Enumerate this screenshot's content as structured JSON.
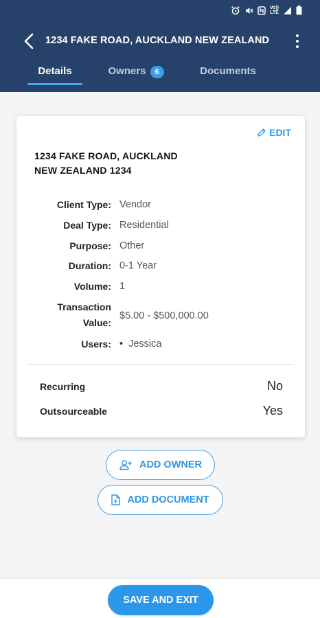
{
  "colors": {
    "header_bg": "#26426a",
    "accent": "#2f9be6",
    "badge": "#3d9cf0",
    "save_button": "#2a97ea"
  },
  "status_bar": {
    "icons": [
      "alarm-icon",
      "mute-icon",
      "nfc-icon",
      "battery-saver-icon",
      "volte-icon",
      "signal-icon",
      "battery-icon"
    ],
    "volte_text": "Vo))\nLTE"
  },
  "header": {
    "title": "1234 FAKE ROAD, AUCKLAND NEW ZEALAND",
    "back_icon": "chevron-left-icon",
    "more_icon": "more-vertical-icon"
  },
  "tabs": [
    {
      "label": "Details",
      "active": true
    },
    {
      "label": "Owners",
      "badge": "6",
      "active": false
    },
    {
      "label": "Documents",
      "active": false
    }
  ],
  "card": {
    "edit_label": "EDIT",
    "edit_icon": "pencil-icon",
    "address_line1": "1234 FAKE ROAD, AUCKLAND",
    "address_line2": "NEW ZEALAND 1234",
    "fields": [
      {
        "label": "Client Type:",
        "value": "Vendor"
      },
      {
        "label": "Deal Type:",
        "value": "Residential"
      },
      {
        "label": "Purpose:",
        "value": "Other"
      },
      {
        "label": "Duration:",
        "value": "0-1 Year"
      },
      {
        "label": "Volume:",
        "value": "1"
      },
      {
        "label_line1": "Transaction",
        "label_line2": "Value:",
        "value": "$5.00 - $500,000.00"
      },
      {
        "label": "Users:",
        "value": "Jessica",
        "bullet": "•"
      }
    ],
    "flags": [
      {
        "label": "Recurring",
        "value": "No"
      },
      {
        "label": "Outsourceable",
        "value": "Yes"
      }
    ]
  },
  "actions": {
    "add_owner_label": "ADD OWNER",
    "add_owner_icon": "add-person-icon",
    "add_document_label": "ADD DOCUMENT",
    "add_document_icon": "document-add-icon"
  },
  "footer": {
    "save_label": "SAVE AND EXIT"
  }
}
